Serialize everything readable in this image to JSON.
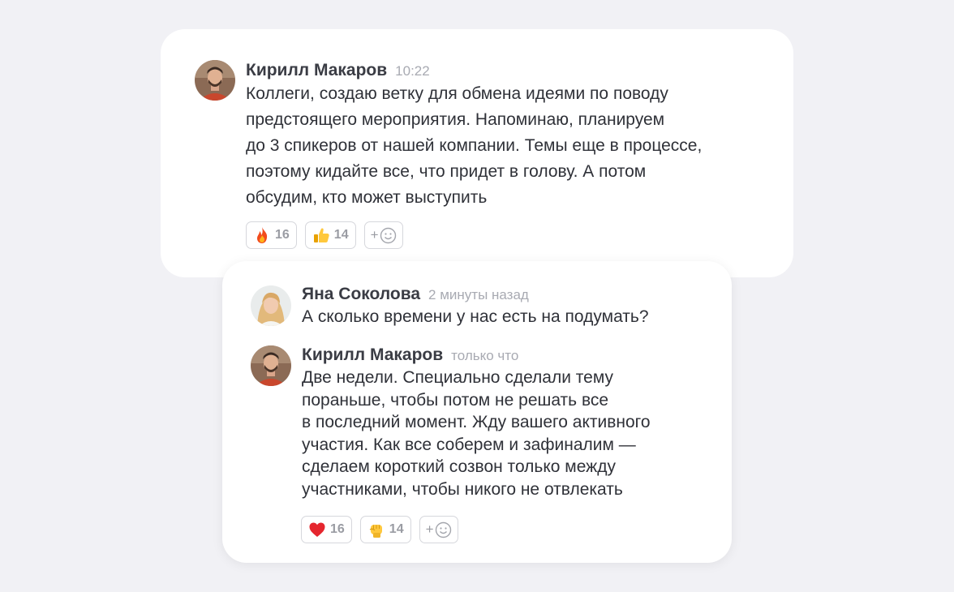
{
  "main_message": {
    "author": "Кирилл Макаров",
    "time": "10:22",
    "lines": [
      "Коллеги, создаю ветку для обмена идеями по поводу",
      "предстоящего мероприятия. Напоминаю, планируем",
      "до 3 спикеров от нашей компании. Темы еще в процессе,",
      "поэтому кидайте все, что придет в голову. А потом",
      "обсудим, кто может выступить"
    ],
    "reactions": [
      {
        "emoji": "fire-icon",
        "count": "16"
      },
      {
        "emoji": "thumbs-up-icon",
        "count": "14"
      }
    ],
    "add_reaction_label": "+"
  },
  "thread": {
    "reply1": {
      "author": "Яна Соколова",
      "time": "2 минуты назад",
      "lines": [
        "А сколько времени у нас есть на подумать?"
      ]
    },
    "reply2": {
      "author": "Кирилл Макаров",
      "time": "только что",
      "lines": [
        "Две недели. Специально сделали тему",
        "пораньше, чтобы потом не решать все",
        "в последний момент. Жду вашего активного",
        "участия. Как все соберем и зафиналим —",
        "сделаем короткий созвон только между",
        "участниками, чтобы никого не отвлекать"
      ],
      "reactions": [
        {
          "emoji": "heart-icon",
          "count": "16"
        },
        {
          "emoji": "raised-fist-icon",
          "count": "14"
        }
      ],
      "add_reaction_label": "+"
    }
  },
  "colors": {
    "background": "#f1f1f5",
    "card": "#ffffff",
    "author_text": "#3a3c44",
    "time_text": "#a8aab2",
    "reaction_border": "#d6d7dc"
  }
}
